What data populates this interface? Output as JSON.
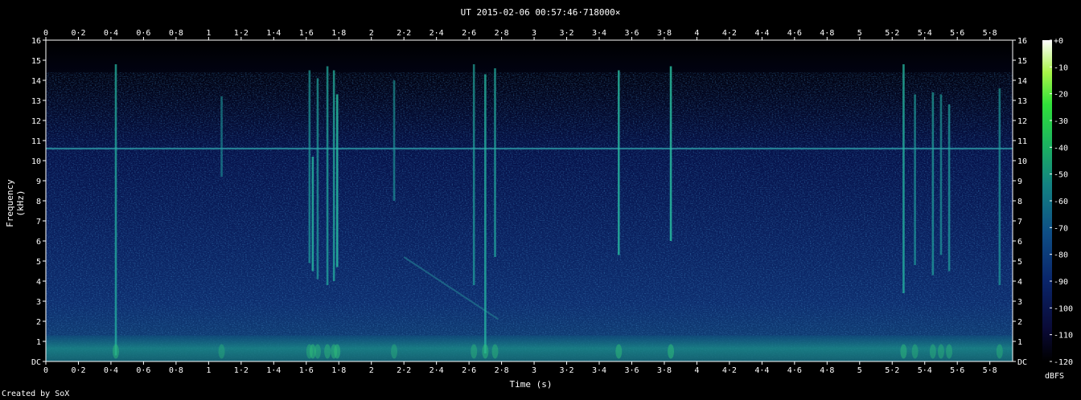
{
  "chart_data": {
    "type": "heatmap",
    "title": "UT 2015-02-06 00:57:46·718000×",
    "xlabel": "Time (s)",
    "ylabel": "Frequency (kHz)",
    "xlim": [
      0,
      5.94
    ],
    "ylim": [
      0,
      16
    ],
    "x_ticks": [
      "0",
      "0·2",
      "0·4",
      "0·6",
      "0·8",
      "1",
      "1·2",
      "1·4",
      "1·6",
      "1·8",
      "2",
      "2·2",
      "2·4",
      "2·6",
      "2·8",
      "3",
      "3·2",
      "3·4",
      "3·6",
      "3·8",
      "4",
      "4·2",
      "4·4",
      "4·6",
      "4·8",
      "5",
      "5·2",
      "5·4",
      "5·6",
      "5·8"
    ],
    "y_ticks": [
      "DC",
      "1",
      "2",
      "3",
      "4",
      "5",
      "6",
      "7",
      "8",
      "9",
      "10",
      "11",
      "12",
      "13",
      "14",
      "15",
      "16"
    ],
    "colorbar": {
      "label": "dBFS",
      "ticks": [
        "+0",
        "-10",
        "-20",
        "-30",
        "-40",
        "-50",
        "-60",
        "-70",
        "-80",
        "-90",
        "-100",
        "-110",
        "-120"
      ],
      "range": [
        -120,
        0
      ],
      "colors": [
        "#000000",
        "#0c0c3a",
        "#0a2a6e",
        "#0f5a8a",
        "#16908a",
        "#1ec05c",
        "#39e83a",
        "#c8f850",
        "#ffffff"
      ]
    },
    "background": {
      "low_freq_band_khz": [
        0,
        1.3
      ],
      "tone_line_khz": 10.6
    },
    "events": [
      {
        "t": 0.43,
        "f_low": 0.3,
        "f_high": 14.8,
        "level": 0.55
      },
      {
        "t": 1.08,
        "f_low": 9.2,
        "f_high": 13.2,
        "level": 0.3
      },
      {
        "t": 1.62,
        "f_low": 4.9,
        "f_high": 14.5,
        "level": 0.4
      },
      {
        "t": 1.64,
        "f_low": 4.5,
        "f_high": 10.2,
        "level": 0.65
      },
      {
        "t": 1.67,
        "f_low": 4.1,
        "f_high": 14.1,
        "level": 0.45
      },
      {
        "t": 1.73,
        "f_low": 3.8,
        "f_high": 14.7,
        "level": 0.5
      },
      {
        "t": 1.77,
        "f_low": 4.0,
        "f_high": 14.5,
        "level": 0.55
      },
      {
        "t": 1.79,
        "f_low": 4.7,
        "f_high": 13.3,
        "level": 0.7
      },
      {
        "t": 2.14,
        "f_low": 8.0,
        "f_high": 14.0,
        "level": 0.35
      },
      {
        "t": 2.63,
        "f_low": 3.8,
        "f_high": 14.8,
        "level": 0.45
      },
      {
        "t": 2.7,
        "f_low": 0.4,
        "f_high": 14.3,
        "level": 0.6
      },
      {
        "t": 2.76,
        "f_low": 5.2,
        "f_high": 14.6,
        "level": 0.5
      },
      {
        "t": 3.52,
        "f_low": 5.3,
        "f_high": 14.5,
        "level": 0.65
      },
      {
        "t": 3.84,
        "f_low": 6.0,
        "f_high": 14.7,
        "level": 0.7
      },
      {
        "t": 5.27,
        "f_low": 3.4,
        "f_high": 14.8,
        "level": 0.6
      },
      {
        "t": 5.34,
        "f_low": 4.8,
        "f_high": 13.3,
        "level": 0.4
      },
      {
        "t": 5.45,
        "f_low": 4.3,
        "f_high": 13.4,
        "level": 0.45
      },
      {
        "t": 5.5,
        "f_low": 5.3,
        "f_high": 13.3,
        "level": 0.4
      },
      {
        "t": 5.55,
        "f_low": 4.5,
        "f_high": 12.8,
        "level": 0.45
      },
      {
        "t": 5.86,
        "f_low": 3.8,
        "f_high": 13.6,
        "level": 0.4
      }
    ],
    "descending_trace": {
      "t_start": 2.2,
      "f_start": 5.2,
      "t_end": 2.78,
      "f_end": 2.1
    }
  },
  "caption": "Created by SoX"
}
